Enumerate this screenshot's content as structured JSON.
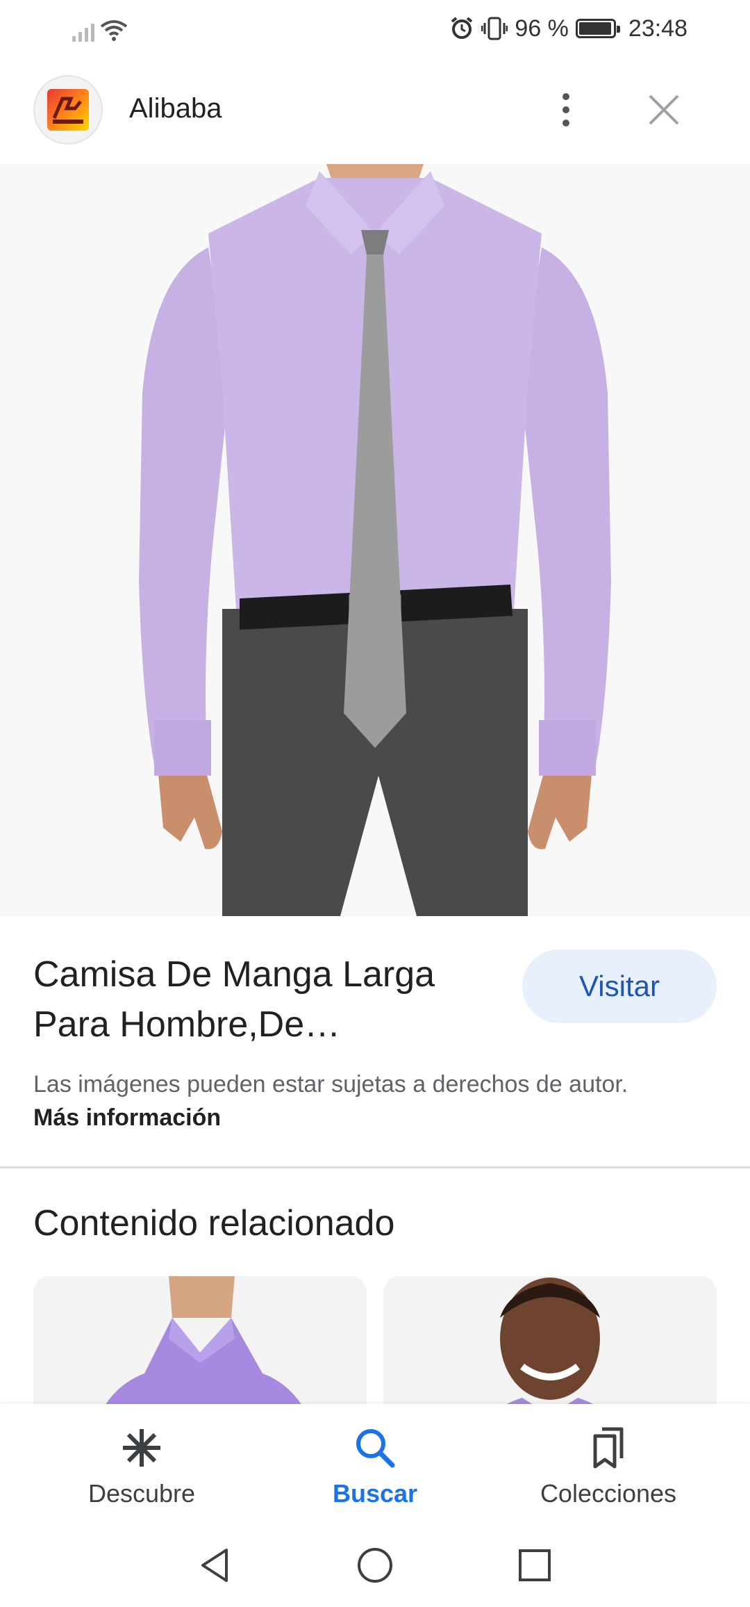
{
  "status_bar": {
    "battery_percent": "96 %",
    "battery_level": 0.96,
    "time": "23:48"
  },
  "header": {
    "site_name": "Alibaba"
  },
  "product": {
    "title": "Camisa De Manga Larga Para Hombre,De…",
    "visit_label": "Visitar",
    "copyright_text": "Las imágenes pueden estar sujetas a derechos de autor.",
    "more_info_label": "Más información"
  },
  "related": {
    "heading": "Contenido relacionado"
  },
  "bottom_nav": {
    "items": [
      {
        "label": "Descubre",
        "icon": "asterisk-icon",
        "active": false
      },
      {
        "label": "Buscar",
        "icon": "search-icon",
        "active": true
      },
      {
        "label": "Colecciones",
        "icon": "bookmarks-icon",
        "active": false
      }
    ]
  },
  "colors": {
    "accent": "#1a73e8",
    "visit_bg": "#e8f0fe",
    "shirt": "#c9b3e6",
    "trousers": "#4a4a4d"
  }
}
